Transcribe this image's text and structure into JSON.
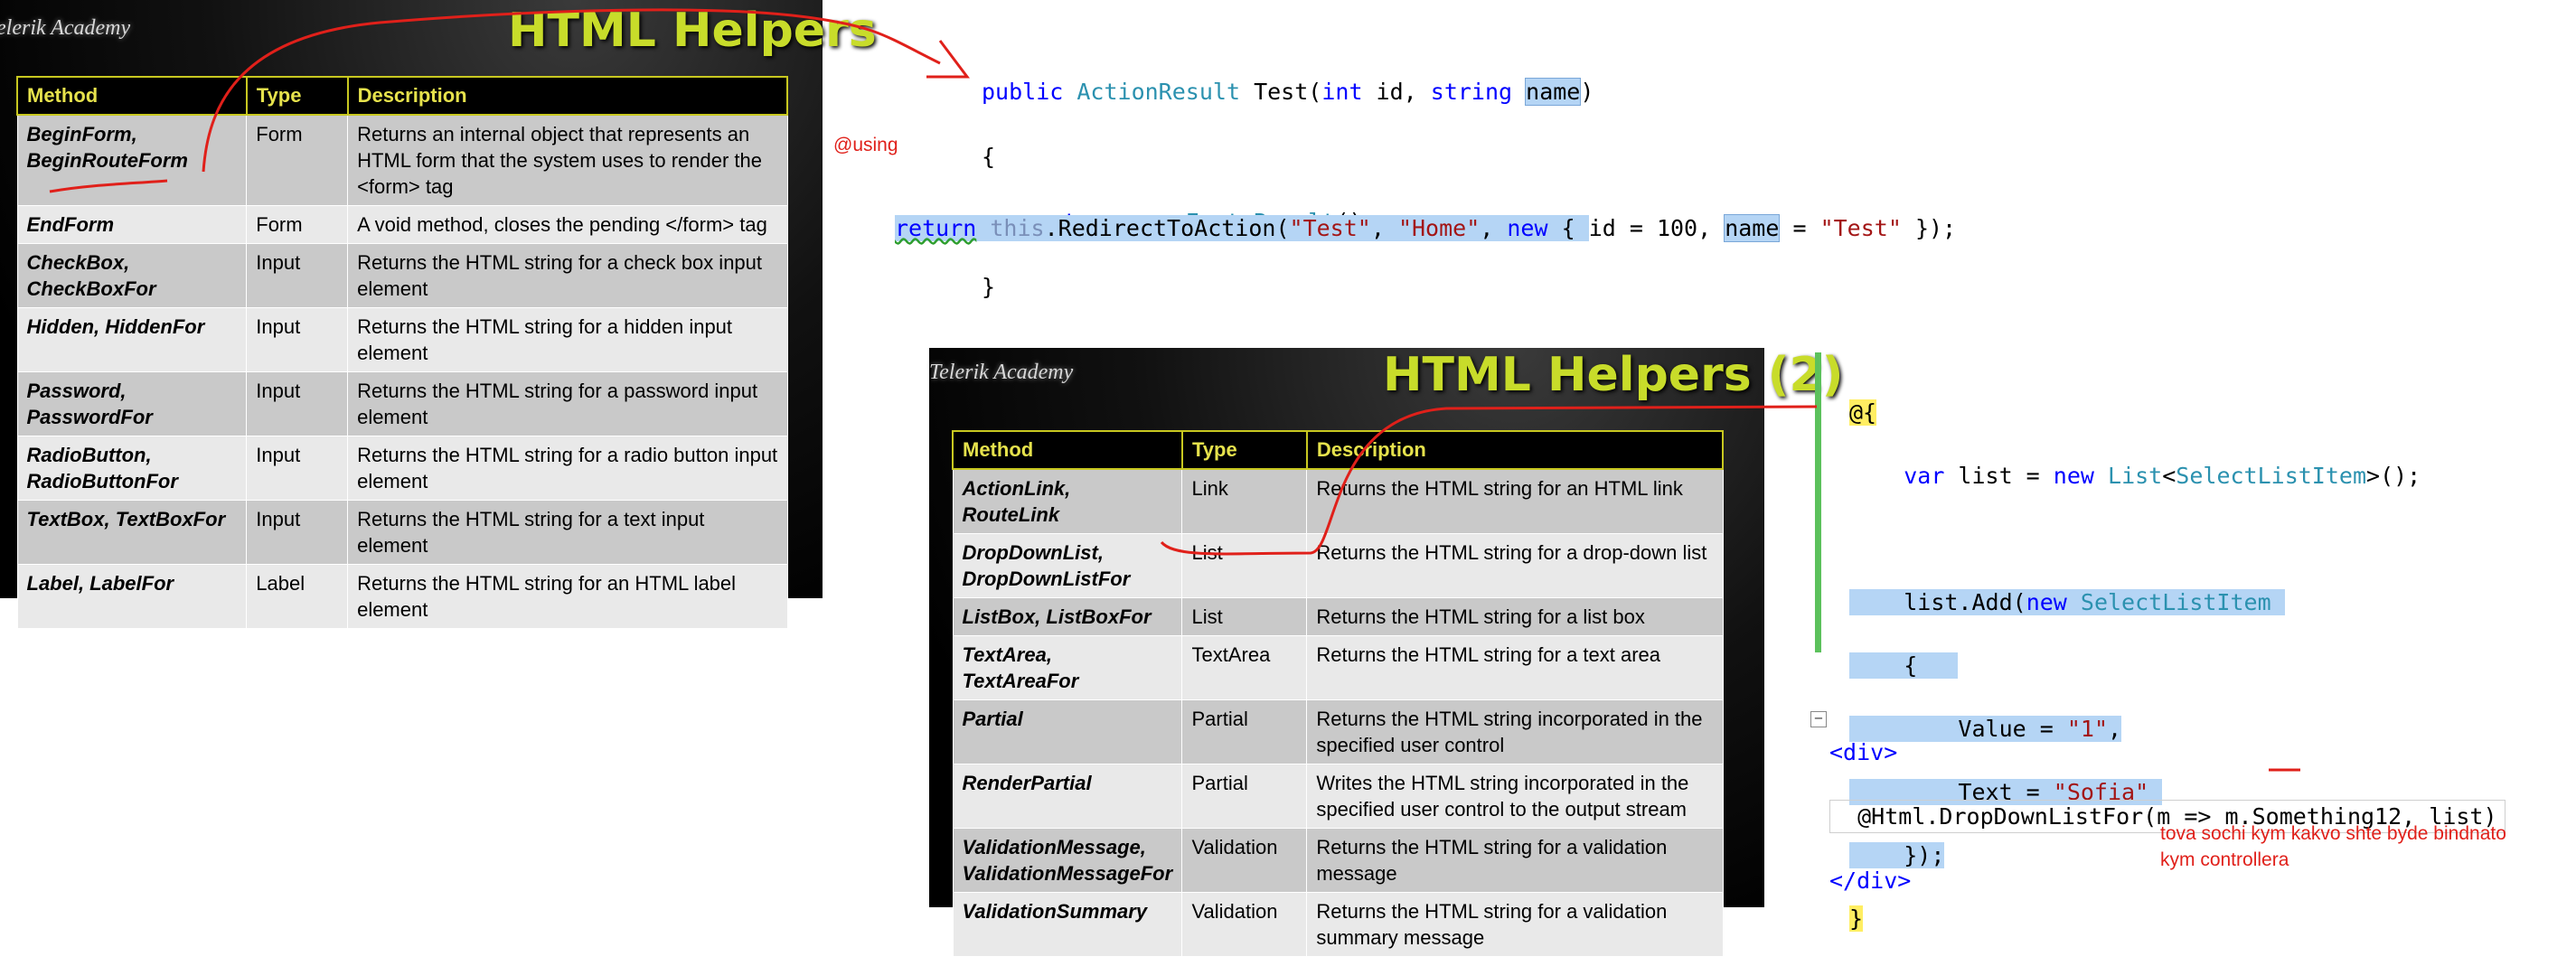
{
  "slide1": {
    "logo": "Telerik Academy",
    "logo_visible": "elerik Academy",
    "title": "HTML Helpers",
    "headers": [
      "Method",
      "Type",
      "Description"
    ],
    "rows": [
      {
        "method": "BeginForm,\nBeginRouteForm",
        "type": "Form",
        "description": "Returns an internal object that represents an HTML form that the system uses to render the <form> tag"
      },
      {
        "method": "EndForm",
        "type": "Form",
        "description": "A void method, closes the pending </form> tag"
      },
      {
        "method": "CheckBox,\nCheckBoxFor",
        "type": "Input",
        "description": "Returns the HTML string for a check box input element"
      },
      {
        "method": "Hidden, HiddenFor",
        "type": "Input",
        "description": "Returns the HTML string for a hidden input element"
      },
      {
        "method": "Password,\nPasswordFor",
        "type": "Input",
        "description": "Returns the HTML string for a password input element"
      },
      {
        "method": "RadioButton,\nRadioButtonFor",
        "type": "Input",
        "description": "Returns the HTML string for a radio button input element"
      },
      {
        "method": "TextBox, TextBoxFor",
        "type": "Input",
        "description": "Returns the HTML string for a text input element"
      },
      {
        "method": "Label, LabelFor",
        "type": "Label",
        "description": "Returns the HTML string for an HTML label element"
      }
    ]
  },
  "slide2": {
    "logo": "Telerik Academy",
    "title": "HTML Helpers (2)",
    "headers": [
      "Method",
      "Type",
      "Description"
    ],
    "rows": [
      {
        "method": "ActionLink, RouteLink",
        "type": "Link",
        "description": "Returns the HTML string for an HTML link"
      },
      {
        "method": "DropDownList,\nDropDownListFor",
        "type": "List",
        "description": "Returns the HTML string for a drop-down list"
      },
      {
        "method": "ListBox, ListBoxFor",
        "type": "List",
        "description": "Returns the HTML string for a list box"
      },
      {
        "method": "TextArea, TextAreaFor",
        "type": "TextArea",
        "description": "Returns the HTML string for a text area"
      },
      {
        "method": "Partial",
        "type": "Partial",
        "description": "Returns the HTML string incorporated in the specified user control"
      },
      {
        "method": "RenderPartial",
        "type": "Partial",
        "description": "Writes the HTML string incorporated in the specified user control to the output stream"
      },
      {
        "method": "ValidationMessage,\nValidationMessageFor",
        "type": "Validation",
        "description": "Returns the HTML string for a validation message"
      },
      {
        "method": "ValidationSummary",
        "type": "Validation",
        "description": "Returns the HTML string for a validation summary message"
      }
    ]
  },
  "code_action": {
    "line1": {
      "kw1": "public",
      "ty1": "ActionResult",
      "name": "Test",
      "open": "(",
      "kw2": "int",
      "p1": " id, ",
      "kw3": "string",
      "p2": " ",
      "p3": "name",
      "close": ")"
    },
    "line2": "{",
    "line3": {
      "kw1": "return",
      "kw2": "new",
      "ty1": "EmptyResult",
      "rest": "();"
    },
    "line4": "}"
  },
  "code_redirect": {
    "kw_return": "return",
    "kw_this": "this",
    "call": ".RedirectToAction(",
    "s1": "\"Test\"",
    "comma1": ", ",
    "s2": "\"Home\"",
    "comma2": ", ",
    "kw_new": "new",
    "brace": " { ",
    "p1": "id = 100, ",
    "p_name": "name",
    "p2": " = ",
    "s3": "\"Test\"",
    "end": " });"
  },
  "code_list": {
    "open": "@{",
    "l1_kw1": "var",
    "l1_a": " list = ",
    "l1_kw2": "new",
    "l1_ty": "List",
    "l1_b": "<",
    "l1_ty2": "SelectListItem",
    "l1_c": ">();",
    "l2_a": "list.Add(",
    "l2_kw": "new",
    "l2_ty": "SelectListItem",
    "l3": "{",
    "l4_a": "Value = ",
    "l4_s": "\"1\"",
    "l4_b": ",",
    "l5_a": "Text = ",
    "l5_s": "\"Sofia\"",
    "l6": "});",
    "close": "}"
  },
  "code_div": {
    "open_tag": "<div>",
    "line": "@Html.DropDownListFor(m => m.Something12, list)",
    "close_tag": "</div>",
    "collapse": "−"
  },
  "notes": {
    "using": "@using",
    "bottom_line1": "tova sochi kym kakvo shte byde bindnato",
    "bottom_line2": "kym controllera"
  },
  "colors": {
    "annotation_red": "#e0201a",
    "slide_title": "#c8dc2a",
    "header_text": "#e6e24c",
    "row_odd": "#c9c9c9",
    "row_even": "#e9e9e9",
    "keyword": "#0000ff",
    "type": "#2b91af",
    "string": "#a31515",
    "selection": "#b5d5f5"
  }
}
